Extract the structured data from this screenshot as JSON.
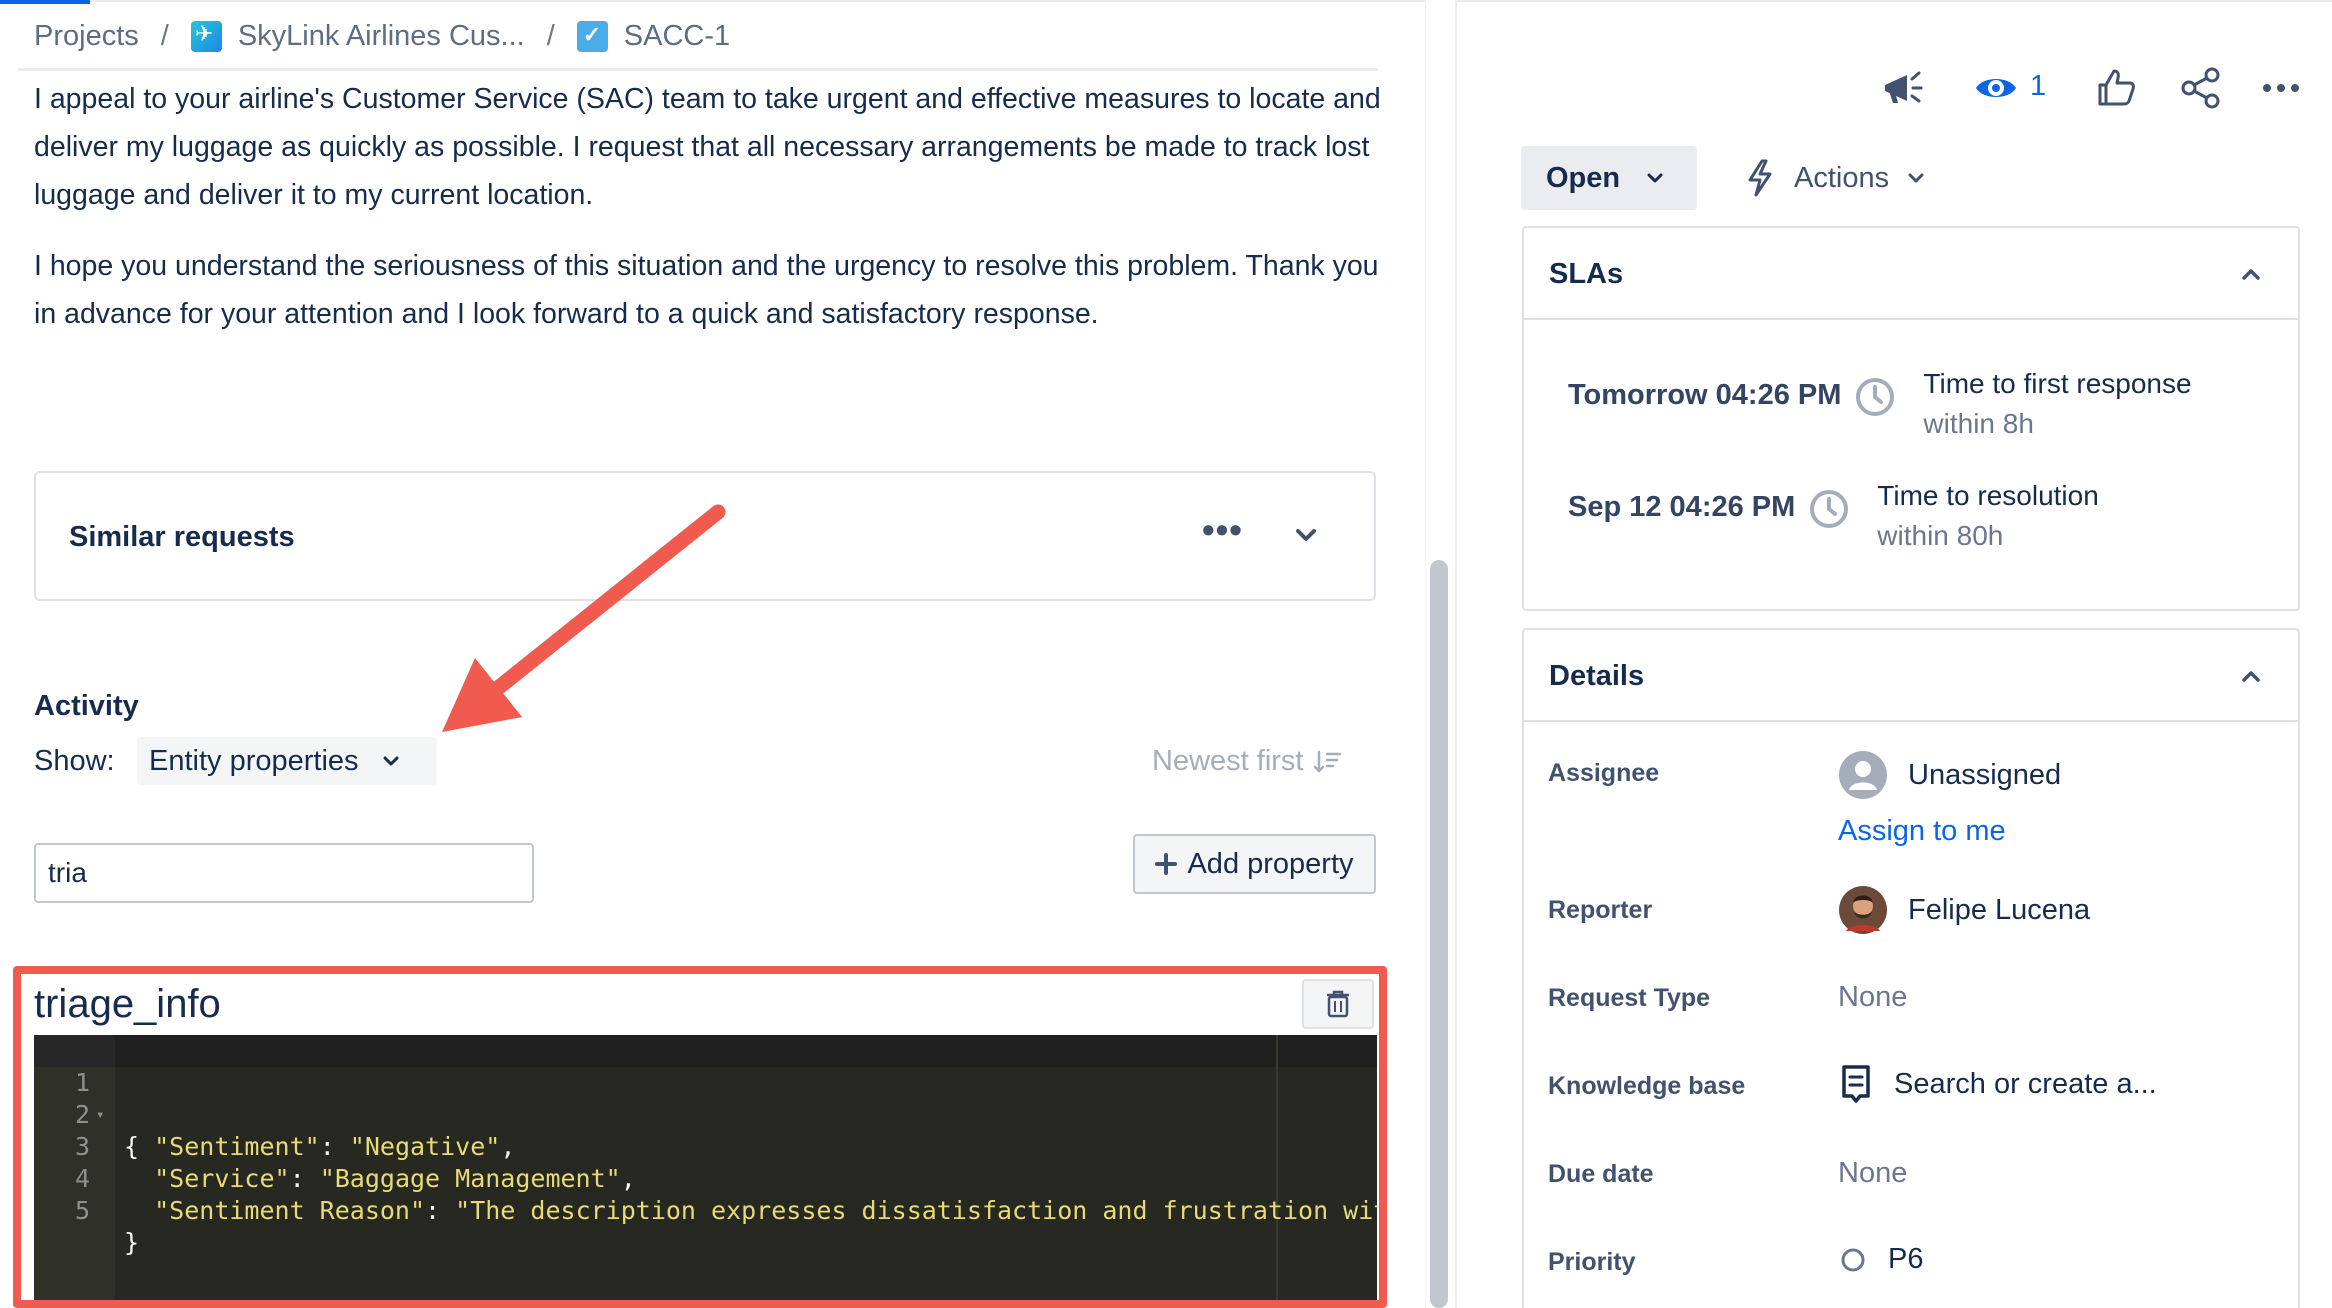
{
  "breadcrumb": {
    "items": [
      "Projects",
      "SkyLink Airlines Cus...",
      "SACC-1"
    ],
    "separator": "/"
  },
  "description": {
    "paragraphs": [
      "I appeal to your airline's Customer Service (SAC) team to take urgent and effective measures to locate and deliver my luggage as quickly as possible. I request that all necessary arrangements be made to track lost luggage and deliver it to my current location.",
      "I hope you understand the seriousness of this situation and the urgency to resolve this problem. Thank you in advance for your attention and I look forward to a quick and satisfactory response."
    ]
  },
  "similar_requests": {
    "title": "Similar requests",
    "more": "•••"
  },
  "activity": {
    "title": "Activity",
    "show_label": "Show:",
    "show_value": "Entity properties",
    "sort_label": "Newest first"
  },
  "property_filter": {
    "value": "tria"
  },
  "add_property": {
    "label": "Add property",
    "plus": "+"
  },
  "property": {
    "name": "triage_info",
    "lines": [
      {
        "n": "1",
        "key": "",
        "val": "",
        "text": "{"
      },
      {
        "n": "2",
        "key": "\"Sentiment\"",
        "val": "\"Negative\"",
        "text": ""
      },
      {
        "n": "3",
        "key": "\"Service\"",
        "val": "\"Baggage Management\"",
        "text": ""
      },
      {
        "n": "4",
        "key": "\"Sentiment Reason\"",
        "val": "\"The description expresses dissatisfaction and frustration with t",
        "text": ""
      },
      {
        "n": "5",
        "key": "",
        "val": "",
        "text": "}"
      }
    ]
  },
  "header_icons": {
    "watchers_count": "1",
    "names": [
      "feedback-megaphone-icon",
      "watch-eye-icon",
      "like-icon",
      "share-icon",
      "more-icon"
    ]
  },
  "status": {
    "label": "Open"
  },
  "actions": {
    "label": "Actions"
  },
  "slas": {
    "title": "SLAs",
    "items": [
      {
        "time": "Tomorrow 04:26 PM",
        "name": "Time to first response",
        "goal": "within 8h"
      },
      {
        "time": "Sep 12 04:26 PM",
        "name": "Time to resolution",
        "goal": "within 80h"
      }
    ]
  },
  "details": {
    "title": "Details",
    "assignee_label": "Assignee",
    "assignee_value": "Unassigned",
    "assign_to_me": "Assign to me",
    "reporter_label": "Reporter",
    "reporter_value": "Felipe Lucena",
    "request_type_label": "Request Type",
    "request_type_value": "None",
    "kb_label": "Knowledge base",
    "kb_value": "Search or create a...",
    "due_date_label": "Due date",
    "due_date_value": "None",
    "priority_label": "Priority",
    "priority_value": "P6"
  },
  "colors": {
    "accent": "#0c66e4",
    "highlight": "#f05a4f",
    "editor_bg": "#272822",
    "string": "#e6db74"
  }
}
